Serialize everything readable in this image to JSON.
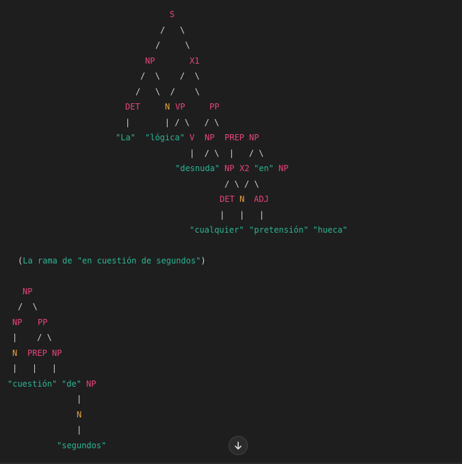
{
  "tree1": {
    "S": "S",
    "NP": "NP",
    "X1": "X1",
    "DET": "DET",
    "N": "N",
    "VP": "VP",
    "PP": "PP",
    "la": "\"La\"",
    "logica": "\"lógica\"",
    "V": "V",
    "NP2": "NP",
    "PREP": "PREP",
    "NP3": "NP",
    "desnuda": "\"desnuda\"",
    "NP4": "NP",
    "X2": "X2",
    "en": "\"en\"",
    "NP5": "NP",
    "DET2": "DET",
    "N2": "N",
    "ADJ": "ADJ",
    "cualquier": "\"cualquier\"",
    "pretension": "\"pretensión\"",
    "hueca": "\"hueca\""
  },
  "note": {
    "open": "(",
    "text": "La rama de \"en cuestión de segundos\"",
    "close": ")"
  },
  "tree2": {
    "NP": "NP",
    "NP2": "NP",
    "PP": "PP",
    "N": "N",
    "PREP": "PREP",
    "NP3": "NP",
    "cuestion": "\"cuestión\"",
    "de": "\"de\"",
    "NP4": "NP",
    "N2": "N",
    "segundos": "\"segundos\""
  },
  "scroll_button": {
    "icon": "arrow-down-icon"
  }
}
